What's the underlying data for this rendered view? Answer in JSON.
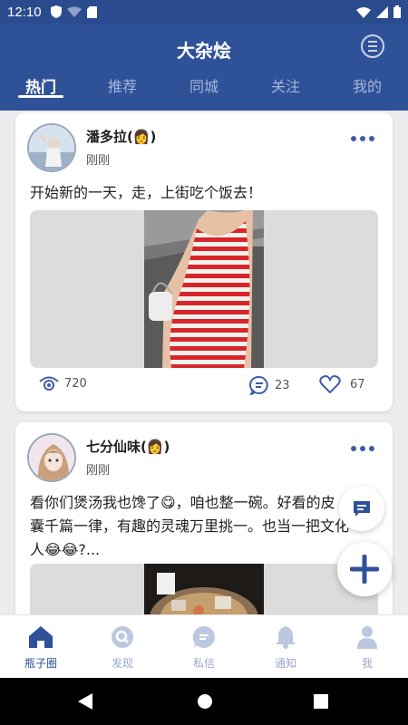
{
  "status_bar": {
    "time": "12:10"
  },
  "header": {
    "title": "大杂烩",
    "tabs": [
      {
        "label": "热门",
        "active": true
      },
      {
        "label": "推荐"
      },
      {
        "label": "同城"
      },
      {
        "label": "关注"
      },
      {
        "label": "我的"
      }
    ]
  },
  "posts": [
    {
      "author": "潘多拉(👩)",
      "time": "刚刚",
      "text": "开始新的一天，走，上街吃个饭去！",
      "views": "720",
      "comments": "23",
      "likes": "67"
    },
    {
      "author": "七分仙味(👩)",
      "time": "刚刚",
      "text": "看你们煲汤我也馋了😋，咱也整一碗。好看的皮囊千篇一律，有趣的灵魂万里挑一。也当一把文化人😂😂?..."
    }
  ],
  "bottom_nav": [
    {
      "label": "瓶子圈",
      "icon": "home-icon",
      "active": true
    },
    {
      "label": "发现",
      "icon": "discover-icon"
    },
    {
      "label": "私信",
      "icon": "message-icon"
    },
    {
      "label": "通知",
      "icon": "bell-icon"
    },
    {
      "label": "我",
      "icon": "profile-icon"
    }
  ],
  "colors": {
    "primary": "#2f5198",
    "nav_inactive": "#9aa9c9",
    "background": "#ececef"
  }
}
